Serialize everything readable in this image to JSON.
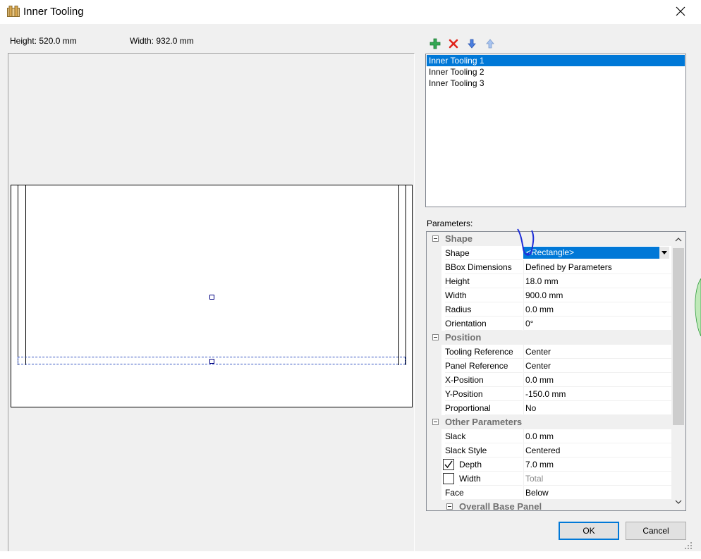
{
  "window": {
    "title": "Inner Tooling"
  },
  "info": {
    "height_label": "Height: 520.0 mm",
    "width_label": "Width: 932.0 mm"
  },
  "toolbar": {
    "add_icon": "plus-icon",
    "delete_icon": "x-icon",
    "move_down_icon": "arrow-down-icon",
    "move_up_icon": "arrow-up-icon"
  },
  "tooling_list": [
    "Inner Tooling 1",
    "Inner Tooling 2",
    "Inner Tooling 3"
  ],
  "selected_index": 0,
  "parameters": {
    "label": "Parameters:",
    "shape": {
      "category": "Shape",
      "shape_label": "Shape",
      "shape_value": "<Rectangle>",
      "rows": [
        {
          "name": "BBox Dimensions",
          "value": "Defined by Parameters"
        },
        {
          "name": "Height",
          "value": "18.0 mm"
        },
        {
          "name": "Width",
          "value": "900.0 mm"
        },
        {
          "name": "Radius",
          "value": "0.0 mm"
        },
        {
          "name": "Orientation",
          "value": "0°"
        }
      ]
    },
    "position": {
      "category": "Position",
      "rows": [
        {
          "name": "Tooling Reference",
          "value": "Center"
        },
        {
          "name": "Panel Reference",
          "value": "Center"
        },
        {
          "name": "X-Position",
          "value": "0.0 mm"
        },
        {
          "name": "Y-Position",
          "value": "-150.0 mm"
        },
        {
          "name": "Proportional",
          "value": "No"
        }
      ]
    },
    "other": {
      "category": "Other Parameters",
      "rows": [
        {
          "name": "Slack",
          "value": "0.0 mm"
        },
        {
          "name": "Slack Style",
          "value": "Centered"
        }
      ],
      "depth": {
        "name": "Depth",
        "value": "7.0 mm",
        "checked": true
      },
      "width": {
        "name": "Width",
        "value": "Total",
        "checked": false
      },
      "face": {
        "name": "Face",
        "value": "Below"
      }
    },
    "overall": {
      "category": "Overall Base Panel"
    }
  },
  "buttons": {
    "ok": "OK",
    "cancel": "Cancel"
  },
  "colors": {
    "selection": "#0078d7",
    "dialog_bg": "#f0f0f0",
    "annotation": "#1f2fd8",
    "accent_green": "#34a853",
    "delete_red": "#e0241b"
  }
}
